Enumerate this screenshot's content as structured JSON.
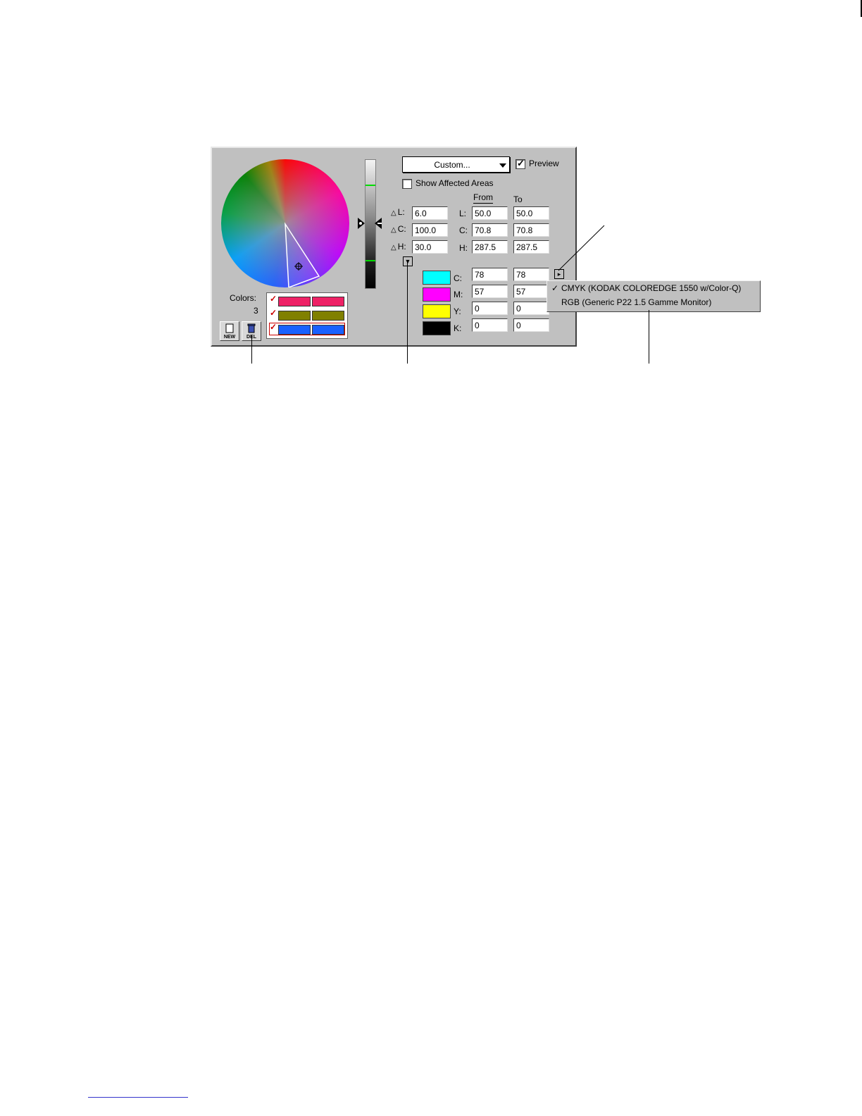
{
  "toolbar": {
    "preset_label": "Custom...",
    "preview_label": "Preview",
    "preview_checked": true,
    "show_affected_label": "Show Affected Areas",
    "show_affected_checked": false
  },
  "tolerance": {
    "dl_label": "L:",
    "dl_value": "6.0",
    "dc_label": "C:",
    "dc_value": "100.0",
    "dh_label": "H:",
    "dh_value": "30.0"
  },
  "headers": {
    "from": "From",
    "to": "To"
  },
  "lch": {
    "l_label": "L:",
    "c_label": "C:",
    "h_label": "H:",
    "from": {
      "l": "50.0",
      "c": "70.8",
      "h": "287.5"
    },
    "to": {
      "l": "50.0",
      "c": "70.8",
      "h": "287.5"
    }
  },
  "cmyk": {
    "c_label": "C:",
    "m_label": "M:",
    "y_label": "Y:",
    "k_label": "K:",
    "from": {
      "c": "78",
      "m": "57",
      "y": "0",
      "k": "0"
    },
    "to": {
      "c": "78",
      "m": "57",
      "y": "0",
      "k": "0"
    },
    "swatch_colors": [
      "#00ffff",
      "#ff00ff",
      "#ffff00",
      "#000000"
    ]
  },
  "colors_panel": {
    "label": "Colors:",
    "count": "3",
    "rows": [
      {
        "from": "#ee2266",
        "to": "#ee2266"
      },
      {
        "from": "#808000",
        "to": "#808000"
      },
      {
        "from": "#1a60ff",
        "to": "#1a60ff"
      }
    ],
    "new_label": "NEW",
    "del_label": "DEL"
  },
  "profile_menu": {
    "items": [
      {
        "label": "CMYK (KODAK COLOREDGE 1550 w/Color-Q)",
        "checked": true
      },
      {
        "label": "RGB (Generic P22 1.5 Gamme Monitor)",
        "checked": false
      }
    ]
  }
}
